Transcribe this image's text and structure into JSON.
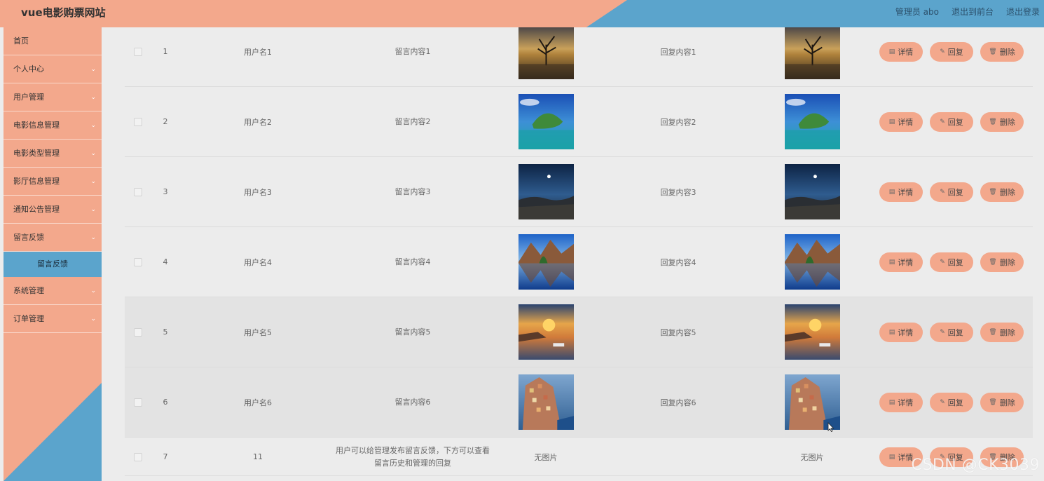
{
  "header": {
    "title": "vue电影购票网站",
    "admin": "管理员 abo",
    "exit_front": "退出到前台",
    "logout": "退出登录"
  },
  "sidebar": {
    "items": [
      {
        "label": "首页"
      },
      {
        "label": "个人中心"
      },
      {
        "label": "用户管理"
      },
      {
        "label": "电影信息管理"
      },
      {
        "label": "电影类型管理"
      },
      {
        "label": "影厅信息管理"
      },
      {
        "label": "通知公告管理"
      },
      {
        "label": "留言反馈"
      },
      {
        "label": "系统管理"
      },
      {
        "label": "订单管理"
      }
    ],
    "active_sub": "留言反馈"
  },
  "table": {
    "ops": {
      "detail": "详情",
      "reply": "回复",
      "delete": "删除"
    },
    "no_image": "无图片",
    "rows": [
      {
        "idx": "1",
        "user": "用户名1",
        "msg": "留言内容1",
        "reply": "回复内容1",
        "img": "lake-tree"
      },
      {
        "idx": "2",
        "user": "用户名2",
        "msg": "留言内容2",
        "reply": "回复内容2",
        "img": "island"
      },
      {
        "idx": "3",
        "user": "用户名3",
        "msg": "留言内容3",
        "reply": "回复内容3",
        "img": "night-sky"
      },
      {
        "idx": "4",
        "user": "用户名4",
        "msg": "留言内容4",
        "reply": "回复内容4",
        "img": "mountain-lake"
      },
      {
        "idx": "5",
        "user": "用户名5",
        "msg": "留言内容5",
        "reply": "回复内容5",
        "img": "sunset-harbor"
      },
      {
        "idx": "6",
        "user": "用户名6",
        "msg": "留言内容6",
        "reply": "回复内容6",
        "img": "cliff-town"
      },
      {
        "idx": "7",
        "user": "11",
        "msg": "用户可以给管理发布留言反馈，下方可以查看留言历史和管理的回复",
        "reply": "",
        "img": ""
      }
    ]
  },
  "watermark": "CSDN @CK3039",
  "colors": {
    "salmon": "#f3a88c",
    "blue": "#5ba4cc"
  }
}
